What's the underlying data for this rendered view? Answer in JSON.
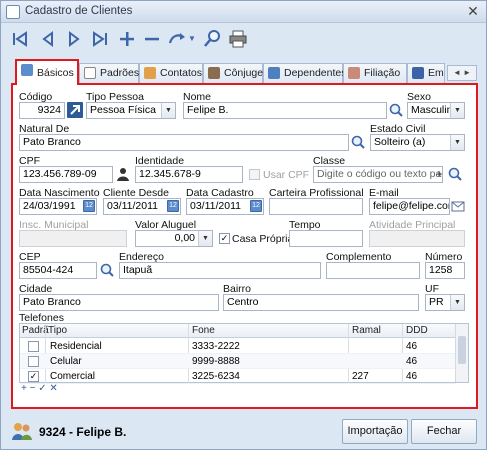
{
  "window": {
    "title": "Cadastro de Clientes",
    "close_glyph": "✕"
  },
  "tabs": [
    {
      "label": "Básicos"
    },
    {
      "label": "Padrões"
    },
    {
      "label": "Contatos"
    },
    {
      "label": "Cônjuge"
    },
    {
      "label": "Dependentes"
    },
    {
      "label": "Filiação"
    },
    {
      "label": "Em"
    }
  ],
  "form": {
    "codigo": {
      "label": "Código",
      "value": "9324"
    },
    "tipo_pessoa": {
      "label": "Tipo Pessoa",
      "value": "Pessoa Física"
    },
    "nome": {
      "label": "Nome",
      "value": "Felipe B."
    },
    "sexo": {
      "label": "Sexo",
      "value": "Masculino"
    },
    "natural_de": {
      "label": "Natural De",
      "value": "Pato Branco"
    },
    "estado_civil": {
      "label": "Estado Civil",
      "value": "Solteiro (a)"
    },
    "cpf": {
      "label": "CPF",
      "value": "123.456.789-09"
    },
    "identidade": {
      "label": "Identidade",
      "value": "12.345.678-9"
    },
    "usar_cpf": {
      "label": "Usar CPF"
    },
    "classe": {
      "label": "Classe",
      "placeholder": "Digite o código ou texto para p"
    },
    "data_nascimento": {
      "label": "Data Nascimento",
      "value": "24/03/1991"
    },
    "cliente_desde": {
      "label": "Cliente Desde",
      "value": "03/11/2011"
    },
    "data_cadastro": {
      "label": "Data Cadastro",
      "value": "03/11/2011"
    },
    "carteira_profissional": {
      "label": "Carteira Profissional",
      "value": ""
    },
    "email": {
      "label": "E-mail",
      "value": "felipe@felipe.com.br"
    },
    "insc_municipal": {
      "label": "Insc. Municipal",
      "value": ""
    },
    "valor_aluguel": {
      "label": "Valor Aluguel",
      "value": "0,00"
    },
    "casa_propria": {
      "label": "Casa Própria",
      "checked": true
    },
    "tempo": {
      "label": "Tempo",
      "value": ""
    },
    "atividade_principal": {
      "label": "Atividade Principal",
      "value": ""
    },
    "cep": {
      "label": "CEP",
      "value": "85504-424"
    },
    "endereco": {
      "label": "Endereço",
      "value": "Itapuã"
    },
    "complemento": {
      "label": "Complemento",
      "value": ""
    },
    "numero": {
      "label": "Número",
      "value": "1258"
    },
    "cidade": {
      "label": "Cidade",
      "value": "Pato Branco"
    },
    "bairro": {
      "label": "Bairro",
      "value": "Centro"
    },
    "uf": {
      "label": "UF",
      "value": "PR"
    }
  },
  "telefones": {
    "label": "Telefones",
    "columns": [
      "Padrã",
      "Tipo",
      "Fone",
      "Ramal",
      "DDD"
    ],
    "rows": [
      {
        "padrao": false,
        "tipo": "Residencial",
        "fone": "3333-2222",
        "ramal": "",
        "ddd": "46"
      },
      {
        "padrao": false,
        "tipo": "Celular",
        "fone": "9999-8888",
        "ramal": "",
        "ddd": "46"
      },
      {
        "padrao": true,
        "tipo": "Comercial",
        "fone": "3225-6234",
        "ramal": "227",
        "ddd": "46"
      }
    ],
    "nav": "+ − ✓ ✕"
  },
  "footer": {
    "client_code": "9324",
    "client_sep": " - ",
    "client_name": "Felipe B.",
    "importacao_label": "Importação",
    "fechar_label": "Fechar"
  },
  "colors": {
    "accent": "#e0191f",
    "toolbar": "#3f66a8"
  }
}
